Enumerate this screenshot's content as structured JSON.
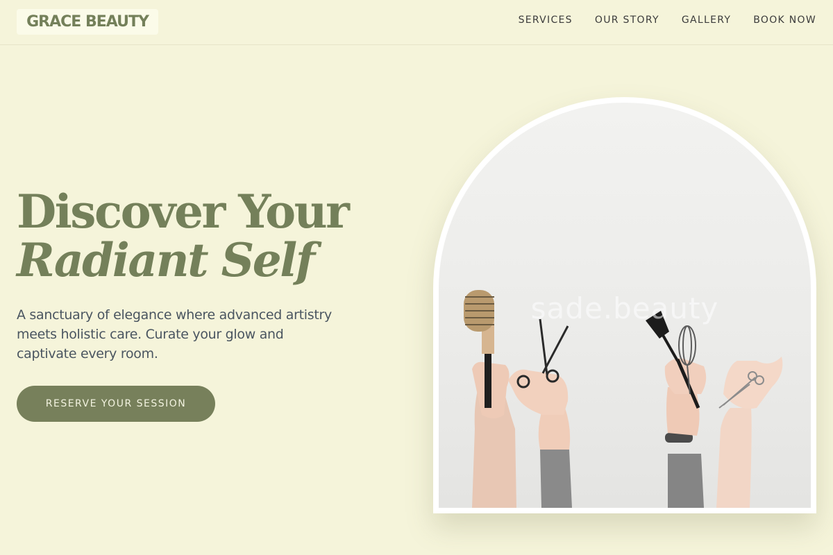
{
  "header": {
    "logo": "GRACE BEAUTY",
    "nav": [
      "SERVICES",
      "OUR STORY",
      "GALLERY",
      "BOOK NOW"
    ]
  },
  "hero": {
    "title_line1": "Discover Your",
    "title_line2": "Radiant Self",
    "subtitle": "A sanctuary of elegance where advanced artistry meets holistic care. Curate your glow and captivate every room.",
    "cta": "RESERVE YOUR SESSION"
  },
  "image": {
    "watermark": "sade.beauty",
    "subject": "hands holding salon tools: round brush, scissors, tint brush, whisk, shears"
  },
  "colors": {
    "background": "#f5f4da",
    "accent": "#77805b",
    "title": "#74805a"
  }
}
